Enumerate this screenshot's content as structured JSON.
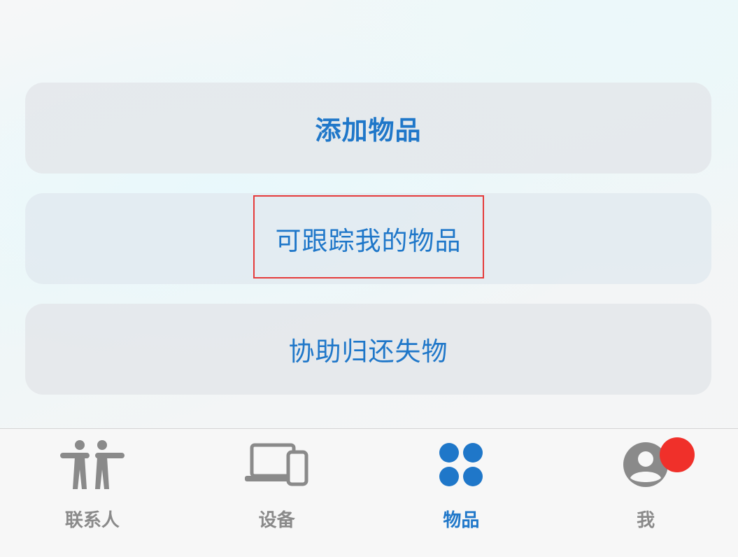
{
  "actions": {
    "add_item": "添加物品",
    "trackable_items": "可跟踪我的物品",
    "help_return": "协助归还失物"
  },
  "tabs": [
    {
      "label": "联系人",
      "icon": "people-icon",
      "active": false
    },
    {
      "label": "设备",
      "icon": "devices-icon",
      "active": false
    },
    {
      "label": "物品",
      "icon": "items-icon",
      "active": true
    },
    {
      "label": "我",
      "icon": "profile-icon",
      "active": false,
      "badge": true
    }
  ],
  "colors": {
    "accent": "#1f77c9",
    "inactive": "#8a8a8a",
    "badge": "#f0302a",
    "highlight": "#e53b3b"
  }
}
